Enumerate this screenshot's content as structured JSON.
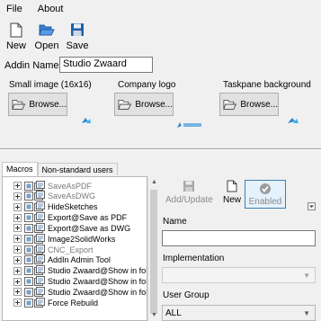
{
  "menu": {
    "file": "File",
    "about": "About"
  },
  "toolbar": {
    "new": "New",
    "open": "Open",
    "save": "Save"
  },
  "addin": {
    "label": "Addin Name",
    "value": "Studio Zwaard"
  },
  "images": {
    "small": {
      "title": "Small image (16x16)",
      "browse": "Browse..."
    },
    "company": {
      "title": "Company logo",
      "browse": "Browse..."
    },
    "taskpane": {
      "title": "Taskpane background",
      "browse": "Browse..."
    }
  },
  "tabs": {
    "macros": "Macros",
    "nonstandard": "Non-standard users"
  },
  "macros": [
    {
      "label": "SaveAsPDF",
      "dim": true
    },
    {
      "label": "SaveAsDWG",
      "dim": true
    },
    {
      "label": "HideSketches",
      "dim": false
    },
    {
      "label": "Export@Save as PDF",
      "dim": false
    },
    {
      "label": "Export@Save as DWG",
      "dim": false
    },
    {
      "label": "Image2SolidWorks",
      "dim": false
    },
    {
      "label": "CNC_Export",
      "dim": true
    },
    {
      "label": "AddIn Admin Tool",
      "dim": false
    },
    {
      "label": "Studio Zwaard@Show in fold",
      "dim": false
    },
    {
      "label": "Studio Zwaard@Show in fold",
      "dim": false
    },
    {
      "label": "Studio Zwaard@Show in fold",
      "dim": false
    },
    {
      "label": "Force Rebuild",
      "dim": false
    }
  ],
  "macro_toolbar": {
    "add_update": "Add/Update",
    "new": "New",
    "enabled": "Enabled"
  },
  "form": {
    "name_label": "Name",
    "name_value": "",
    "implementation_label": "Implementation",
    "implementation_value": "",
    "user_group_label": "User Group",
    "user_group_value": "ALL"
  },
  "colors": {
    "accent": "#3c7fb1",
    "save_icon": "#1f5fa8"
  }
}
